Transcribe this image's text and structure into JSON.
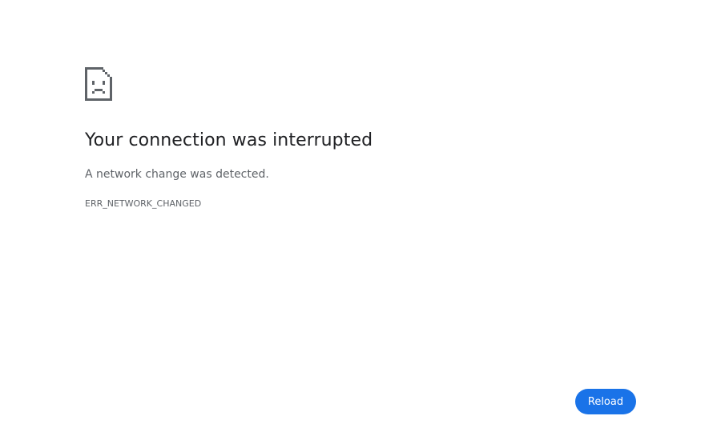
{
  "error_page": {
    "icon": "sad-document-icon",
    "title": "Your connection was interrupted",
    "message": "A network change was detected.",
    "error_code": "ERR_NETWORK_CHANGED"
  },
  "actions": {
    "reload_label": "Reload"
  },
  "colors": {
    "accent": "#1a73e8",
    "title_text": "#202124",
    "secondary_text": "#5f6368",
    "icon": "#5f6368"
  }
}
